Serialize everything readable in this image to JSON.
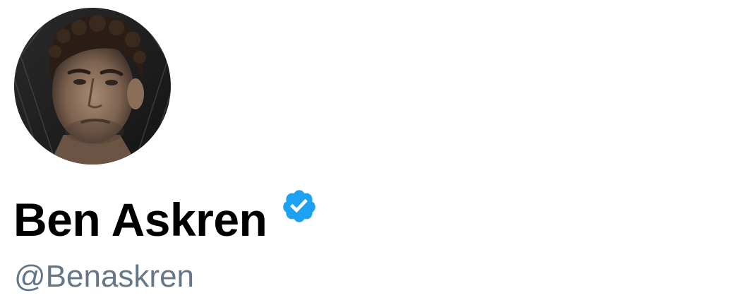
{
  "profile": {
    "display_name": "Ben Askren",
    "handle": "@Benaskren",
    "verified": true,
    "avatar_icon": "profile-photo",
    "badge_icon": "verified-badge-icon"
  },
  "colors": {
    "name_text": "#000000",
    "handle_text": "#657786",
    "verified_blue": "#1DA1F2",
    "background": "#FFFFFF"
  }
}
